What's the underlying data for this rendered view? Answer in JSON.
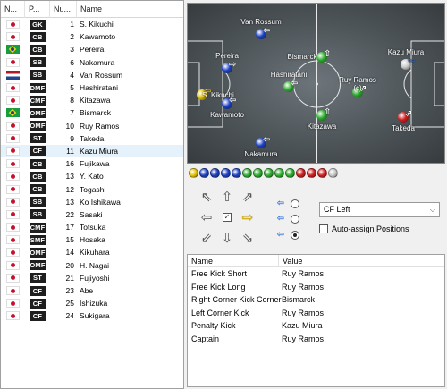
{
  "squad": {
    "headers": [
      "N...",
      "P...",
      "Nu...",
      "Name"
    ],
    "rows": [
      {
        "nat": "jp",
        "pos": "GK",
        "num": "1",
        "name": "S. Kikuchi"
      },
      {
        "nat": "jp",
        "pos": "CB",
        "num": "2",
        "name": "Kawamoto"
      },
      {
        "nat": "br",
        "pos": "CB",
        "num": "3",
        "name": "Pereira"
      },
      {
        "nat": "jp",
        "pos": "SB",
        "num": "6",
        "name": "Nakamura"
      },
      {
        "nat": "nl",
        "pos": "SB",
        "num": "4",
        "name": "Van Rossum"
      },
      {
        "nat": "jp",
        "pos": "DMF",
        "num": "5",
        "name": "Hashiratani"
      },
      {
        "nat": "jp",
        "pos": "CMF",
        "num": "8",
        "name": "Kitazawa"
      },
      {
        "nat": "br",
        "pos": "OMF",
        "num": "7",
        "name": "Bismarck"
      },
      {
        "nat": "jp",
        "pos": "OMF",
        "num": "10",
        "name": "Ruy Ramos"
      },
      {
        "nat": "jp",
        "pos": "ST",
        "num": "9",
        "name": "Takeda"
      },
      {
        "nat": "jp",
        "pos": "CF",
        "num": "11",
        "name": "Kazu Miura"
      },
      {
        "nat": "jp",
        "pos": "CB",
        "num": "16",
        "name": "Fujikawa"
      },
      {
        "nat": "jp",
        "pos": "CB",
        "num": "13",
        "name": "Y. Kato"
      },
      {
        "nat": "jp",
        "pos": "CB",
        "num": "12",
        "name": "Togashi"
      },
      {
        "nat": "jp",
        "pos": "SB",
        "num": "13",
        "name": "Ko Ishikawa"
      },
      {
        "nat": "jp",
        "pos": "SB",
        "num": "22",
        "name": "Sasaki"
      },
      {
        "nat": "jp",
        "pos": "CMF",
        "num": "17",
        "name": "Totsuka"
      },
      {
        "nat": "jp",
        "pos": "SMF",
        "num": "15",
        "name": "Hosaka"
      },
      {
        "nat": "jp",
        "pos": "OMF",
        "num": "14",
        "name": "Kikuhara"
      },
      {
        "nat": "jp",
        "pos": "OMF",
        "num": "20",
        "name": "H. Nagai"
      },
      {
        "nat": "jp",
        "pos": "ST",
        "num": "21",
        "name": "Fujiyoshi"
      },
      {
        "nat": "jp",
        "pos": "CF",
        "num": "23",
        "name": "Abe"
      },
      {
        "nat": "jp",
        "pos": "CF",
        "num": "25",
        "name": "Ishizuka"
      },
      {
        "nat": "jp",
        "pos": "CF",
        "num": "24",
        "name": "Sukigara"
      }
    ],
    "selected_index": 10
  },
  "pitch": {
    "players": [
      {
        "name": "S. Kikuchi",
        "color": "#e7c400",
        "arrow": "⇦",
        "arrow_color": "#f0c800"
      },
      {
        "name": "Pereira",
        "color": "#1b3fc2",
        "arrow": "⇨",
        "arrow_color": "#ffffff"
      },
      {
        "name": "Kawamoto",
        "color": "#1b3fc2",
        "arrow": "⇦",
        "arrow_color": "#ffffff"
      },
      {
        "name": "Van Rossum",
        "color": "#1b3fc2",
        "arrow": "⇦",
        "arrow_color": "#ffffff"
      },
      {
        "name": "Nakamura",
        "color": "#1b3fc2",
        "arrow": "⇦",
        "arrow_color": "#ffffff"
      },
      {
        "name": "Hashiratani",
        "color": "#2fae2f",
        "arrow": "⇦",
        "arrow_color": "#ffffff"
      },
      {
        "name": "Bismarck",
        "color": "#2fae2f",
        "arrow": "⇧",
        "arrow_color": "#ffffff"
      },
      {
        "name": "Kitazawa",
        "color": "#2fae2f",
        "arrow": "⇧",
        "arrow_color": "#ffffff"
      },
      {
        "name": "Ruy Ramos\n(c)",
        "color": "#2fae2f",
        "arrow": "⇗",
        "arrow_color": "#ffffff"
      },
      {
        "name": "Kazu Miura",
        "color": "#c8c8c8",
        "arrow": "⇦",
        "arrow_color": "#2a6bd8"
      },
      {
        "name": "Takeda",
        "color": "#d21e1e",
        "arrow": "⇗",
        "arrow_color": "#ffffff"
      }
    ]
  },
  "strip_colors": [
    "#e7c400",
    "#1b3fc2",
    "#1b3fc2",
    "#1b3fc2",
    "#1b3fc2",
    "#2fae2f",
    "#2fae2f",
    "#2fae2f",
    "#2fae2f",
    "#2fae2f",
    "#d21e1e",
    "#d21e1e",
    "#d21e1e",
    "#c8c8c8"
  ],
  "controls": {
    "position_select": "CF Left",
    "auto_assign_label": "Auto-assign Positions"
  },
  "roles": {
    "headers": [
      "Name",
      "Value"
    ],
    "rows": [
      {
        "role": "Free Kick Short",
        "value": "Ruy Ramos"
      },
      {
        "role": "Free Kick Long",
        "value": "Ruy Ramos"
      },
      {
        "role": "Right Corner Kick Corner",
        "value": "Bismarck"
      },
      {
        "role": "Left Corner Kick",
        "value": "Ruy Ramos"
      },
      {
        "role": "Penalty Kick",
        "value": "Kazu Miura"
      },
      {
        "role": "Captain",
        "value": "Ruy Ramos"
      }
    ]
  }
}
